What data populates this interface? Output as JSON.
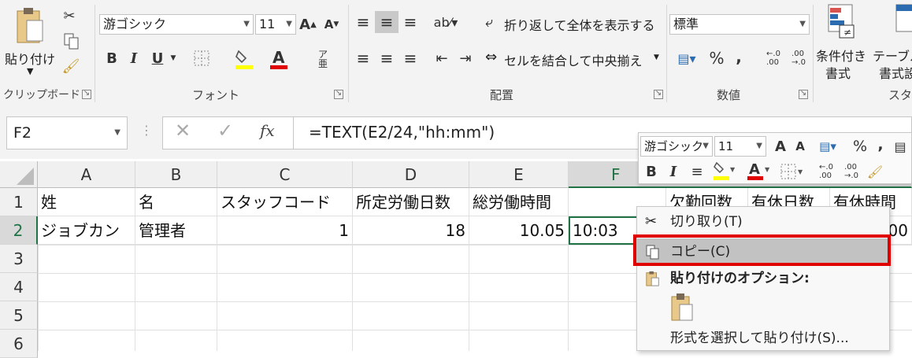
{
  "ribbon": {
    "clipboard": {
      "paste_label": "貼り付け",
      "group_label": "クリップボード"
    },
    "font": {
      "font_name": "游ゴシック",
      "font_size": "11",
      "bold": "B",
      "italic": "I",
      "underline": "U",
      "group_label": "フォント"
    },
    "alignment": {
      "wrap_text": "折り返して全体を表示する",
      "merge_center": "セルを結合して中央揃え",
      "group_label": "配置"
    },
    "number": {
      "format": "標準",
      "percent": "%",
      "comma": ",",
      "group_label": "数値"
    },
    "styles": {
      "conditional_line1": "条件付き",
      "conditional_line2": "書式",
      "table_line1": "テーブル",
      "table_line2": "書式設",
      "group_label": "スタ"
    }
  },
  "formula_bar": {
    "name_box": "F2",
    "formula": "=TEXT(E2/24,\"hh:mm\")"
  },
  "sheet": {
    "columns": [
      "A",
      "B",
      "C",
      "D",
      "E",
      "F"
    ],
    "rows": [
      "1",
      "2",
      "3",
      "4",
      "5",
      "6"
    ],
    "row1": [
      "姓",
      "名",
      "スタッフコード",
      "所定労働日数",
      "総労働時間",
      "",
      "欠勤回数",
      "有休日数",
      "有休時間"
    ],
    "row2": [
      "ジョブカン",
      "管理者",
      "1",
      "18",
      "10.05",
      "10:03",
      "",
      "",
      "00"
    ]
  },
  "mini_toolbar": {
    "font_name": "游ゴシック",
    "font_size": "11",
    "percent": "%",
    "comma": ","
  },
  "context_menu": {
    "cut": "切り取り(T)",
    "copy": "コピー(C)",
    "paste_options": "貼り付けのオプション:",
    "paste_special": "形式を選択して貼り付け(S)..."
  },
  "colors": {
    "highlight_box": "#e00000",
    "selected_item_bg": "#c2c2c2",
    "active_cell_border": "#217346",
    "ribbon_bg": "#f3f3f3"
  }
}
